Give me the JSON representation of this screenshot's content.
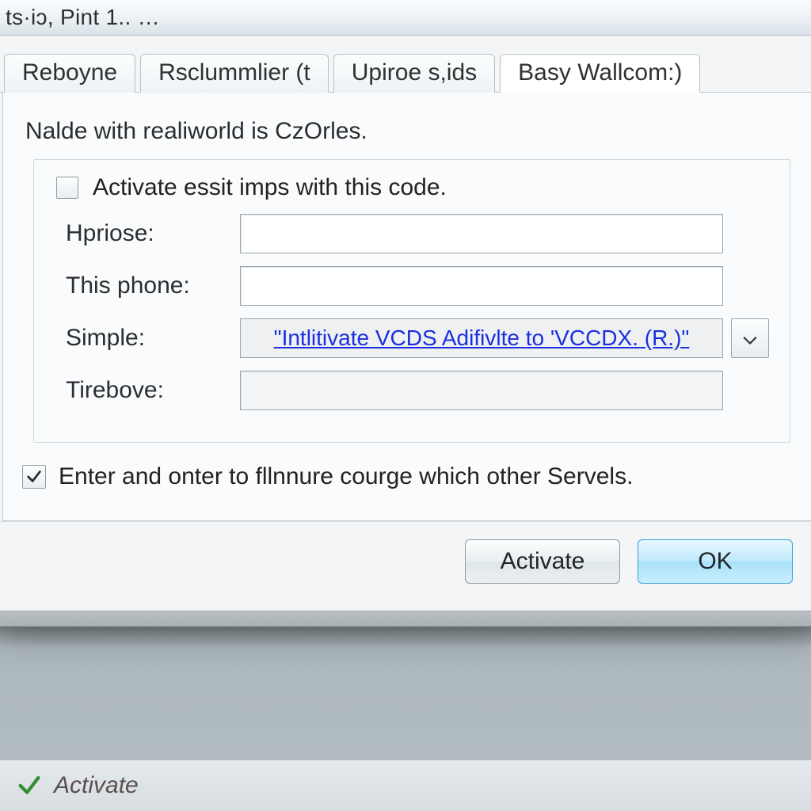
{
  "window": {
    "title": "ts·iɔ, Pint 1..  …"
  },
  "tabs": [
    {
      "label": "Reboyne",
      "active": false
    },
    {
      "label": "Rsclummlier (t",
      "active": false
    },
    {
      "label": "Upiroe s,ids",
      "active": false
    },
    {
      "label": "Basy Wallcom:)",
      "active": true
    }
  ],
  "panel": {
    "intro_text": "Nalde with realiworld is CzOrles.",
    "checkbox_activate": {
      "label": "Activate essit imps with this code.",
      "checked": false
    },
    "fields": {
      "hpriose": {
        "label": "Hpriose:",
        "value": ""
      },
      "this_phone": {
        "label": "This phone:",
        "value": ""
      },
      "simple": {
        "label": "Simple:",
        "link_text": "\"Intlitivate VCDS Adifivlte to 'VCCDX. (R.)\""
      },
      "tirebove": {
        "label": "Tirebove:",
        "value": ""
      }
    },
    "lower_checkbox": {
      "label": "Enter and onter to fllnnure courge which other Servels.",
      "checked": true
    }
  },
  "buttons": {
    "activate": "Activate",
    "ok": "OK"
  },
  "background_status": {
    "label": "Activate"
  }
}
